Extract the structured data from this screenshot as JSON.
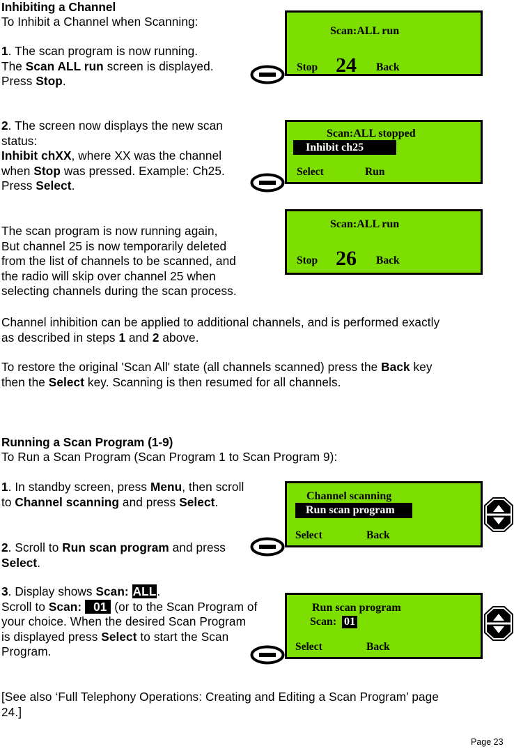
{
  "document": {
    "page_label": "Page 23"
  },
  "sections": {
    "inhibiting": {
      "heading": "Inhibiting a Channel",
      "intro": "To Inhibit a Channel when Scanning:",
      "step1": {
        "num": "1",
        "line1": ". The scan program is now running.",
        "line2_pre": "The ",
        "line2_bold": "Scan ALL run",
        "line2_post": " screen is displayed.",
        "line3_pre": "Press ",
        "line3_bold": "Stop",
        "line3_post": "."
      },
      "step2": {
        "num": "2",
        "line1": ". The screen now displays the new scan",
        "line2": "status:",
        "line3_bold": "Inhibit chXX",
        "line3_post": ", where XX was the channel",
        "line4_pre": "when ",
        "line4_bold": "Stop",
        "line4_post": " was pressed. Example: Ch25.",
        "line5_pre": "Press ",
        "line5_bold": "Select",
        "line5_post": "."
      },
      "explain": {
        "line1": "The scan program is now running again,",
        "line2": "But channel 25 is now temporarily deleted",
        "line3": "from the list of channels to be scanned, and",
        "line4": "the radio will skip over channel 25 when",
        "line5": "selecting channels during the scan process."
      },
      "note1": {
        "line1": "Channel inhibition can be applied to additional channels, and is performed exactly",
        "line2_pre": "as described in steps ",
        "line2_b1": "1",
        "line2_mid": " and ",
        "line2_b2": "2",
        "line2_post": " above."
      },
      "note2": {
        "line1_pre": "To restore the original 'Scan All' state (all channels scanned) press the ",
        "line1_bold": "Back",
        "line1_post": " key",
        "line2_pre": "then the ",
        "line2_bold": "Select",
        "line2_post": " key. Scanning is then resumed for all channels."
      }
    },
    "running": {
      "heading": "Running a Scan Program (1-9)",
      "intro": "To Run a Scan Program (Scan Program 1 to Scan Program 9):",
      "step1": {
        "num": "1",
        "line1_pre": ". In standby screen, press ",
        "line1_b1": "Menu",
        "line1_post": ", then scroll",
        "line2_pre": "to ",
        "line2_b1": "Channel scanning",
        "line2_mid": " and press ",
        "line2_b2": "Select",
        "line2_post": "."
      },
      "step2": {
        "num": "2",
        "line1_pre": ". Scroll to ",
        "line1_b1": "Run scan program",
        "line1_post": " and press",
        "line2_b1": "Select",
        "line2_post": "."
      },
      "step3": {
        "num": "3",
        "line1_pre": ". Display shows ",
        "line1_b1": "Scan: ",
        "line1_inv": "ALL",
        "line1_post": ".",
        "line2_pre": "Scroll to ",
        "line2_b1": "Scan: ",
        "line2_inv": "01",
        "line2_post": " (or to the Scan Program of",
        "line3": "your choice. When the desired Scan Program",
        "line4_pre": "is displayed press ",
        "line4_b1": "Select",
        "line4_post": " to start the Scan",
        "line5": "Program."
      }
    },
    "see_also": {
      "line1": "[See also ‘Full Telephony Operations: Creating and Editing a Scan Program’ page",
      "line2": "24.]"
    }
  },
  "screens": [
    {
      "id": "scan-all-run-24",
      "title": "Scan:ALL run",
      "big_number": "24",
      "left_soft": "Stop",
      "right_soft": "Back"
    },
    {
      "id": "scan-all-stopped",
      "title": "Scan:ALL stopped",
      "highlight": "Inhibit ch25",
      "left_soft": "Select",
      "right_soft": "Run"
    },
    {
      "id": "scan-all-run-26",
      "title": "Scan:ALL run",
      "big_number": "26",
      "left_soft": "Stop",
      "right_soft": "Back"
    },
    {
      "id": "channel-scanning",
      "title": "Channel scanning",
      "highlight": "Run scan program",
      "left_soft": "Select",
      "right_soft": "Back"
    },
    {
      "id": "run-scan-program",
      "title": "Run scan program",
      "field_label": "Scan:",
      "field_value": "01",
      "left_soft": "Select",
      "right_soft": "Back"
    }
  ],
  "icons": {
    "select_key": "oval-select-key-icon",
    "scroll_key": "octagon-scroll-key-icon"
  },
  "colors": {
    "lcd_green": "#7ddf00",
    "ink": "#000000",
    "paper": "#ffffff"
  }
}
